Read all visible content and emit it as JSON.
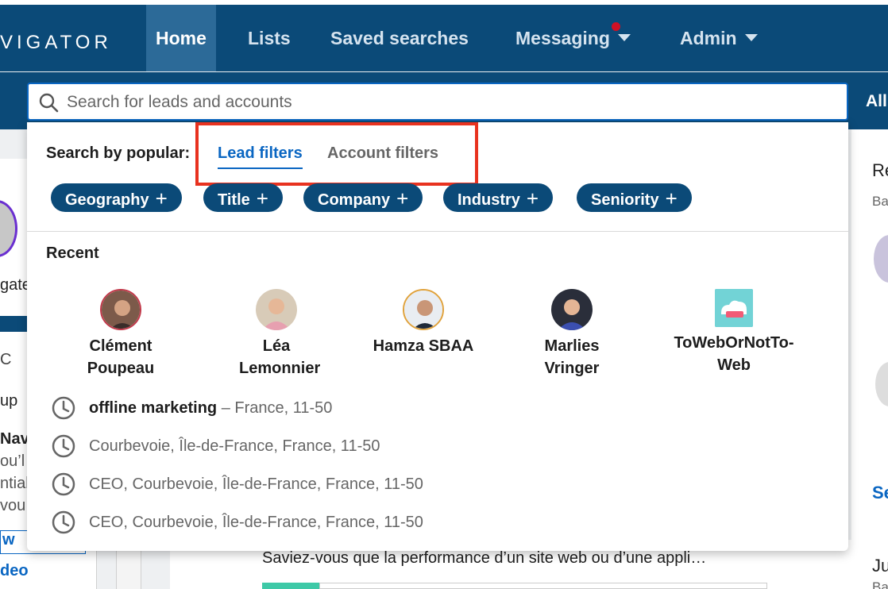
{
  "app": {
    "logo_text": "VIGATOR",
    "accent_color": "#0a66c2",
    "nav_bg_color": "#0b4a78"
  },
  "nav": {
    "items": [
      {
        "label": "Home",
        "active": true
      },
      {
        "label": "Lists"
      },
      {
        "label": "Saved searches"
      },
      {
        "label": "Messaging",
        "has_dropdown": true,
        "has_notification": true
      },
      {
        "label": "Admin",
        "has_dropdown": true
      }
    ]
  },
  "search": {
    "placeholder": "Search for leads and accounts",
    "value": "",
    "scope_label": "All"
  },
  "dropdown": {
    "popular_label": "Search by popular:",
    "tabs": [
      {
        "label": "Lead filters",
        "active": true
      },
      {
        "label": "Account filters"
      }
    ],
    "chips": [
      {
        "label": "Geography"
      },
      {
        "label": "Title"
      },
      {
        "label": "Company"
      },
      {
        "label": "Industry"
      },
      {
        "label": "Seniority"
      }
    ],
    "recent_label": "Recent",
    "recent_people": [
      {
        "name": "Clément Poupeau",
        "icon": "person-avatar"
      },
      {
        "name": "Léa Lemonnier",
        "icon": "person-avatar"
      },
      {
        "name": "Hamza SBAA",
        "icon": "person-avatar"
      },
      {
        "name": "Marlies Vringer",
        "icon": "person-avatar"
      },
      {
        "name": "ToWebOrNotTo-Web",
        "icon": "company-logo",
        "logo_text": "to web or not to web"
      }
    ],
    "history": [
      {
        "bold": "offline marketing",
        "rest": " – France, 11-50"
      },
      {
        "bold": "",
        "rest": "Courbevoie, Île-de-France, France, 11-50"
      },
      {
        "bold": "",
        "rest": "CEO, Courbevoie, Île-de-France, France, 11-50"
      },
      {
        "bold": "",
        "rest": "CEO, Courbevoie, Île-de-France, France, 11-50"
      }
    ]
  },
  "background": {
    "left_fragments": [
      "gate",
      "C E",
      "up",
      "Nav",
      "ou’l",
      "ntial",
      "vou",
      "w",
      "deo"
    ],
    "right_fragments": [
      "Re",
      "Ba",
      "Se",
      "Ju",
      "Ba"
    ],
    "post_text": "Saviez-vous que la performance d’un site web ou d’une appli…"
  }
}
